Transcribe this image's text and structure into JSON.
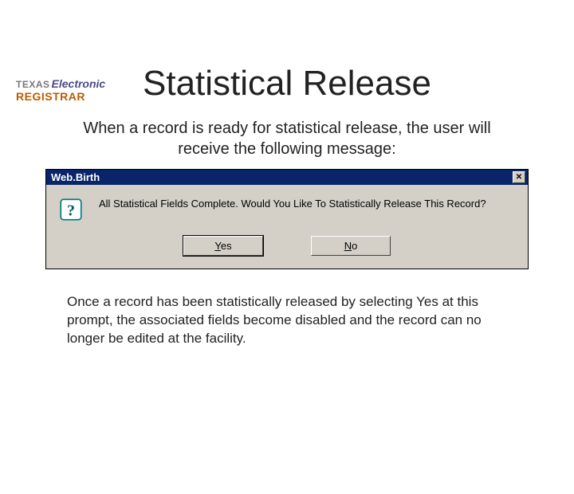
{
  "logo": {
    "texas": "TEXAS",
    "electronic": "Electronic",
    "registrar": "REGISTRAR"
  },
  "title": "Statistical Release",
  "intro": "When a record is ready for statistical release, the user will receive the following message:",
  "dialog": {
    "title": "Web.Birth",
    "close_label": "✕",
    "message": "All Statistical Fields Complete. Would You Like To Statistically Release This Record?",
    "yes_prefix": "Y",
    "yes_rest": "es",
    "no_prefix": "N",
    "no_rest": "o"
  },
  "outro": "Once a record has been statistically released by selecting Yes at this prompt, the associated fields become disabled and the record can no longer be edited at the facility."
}
